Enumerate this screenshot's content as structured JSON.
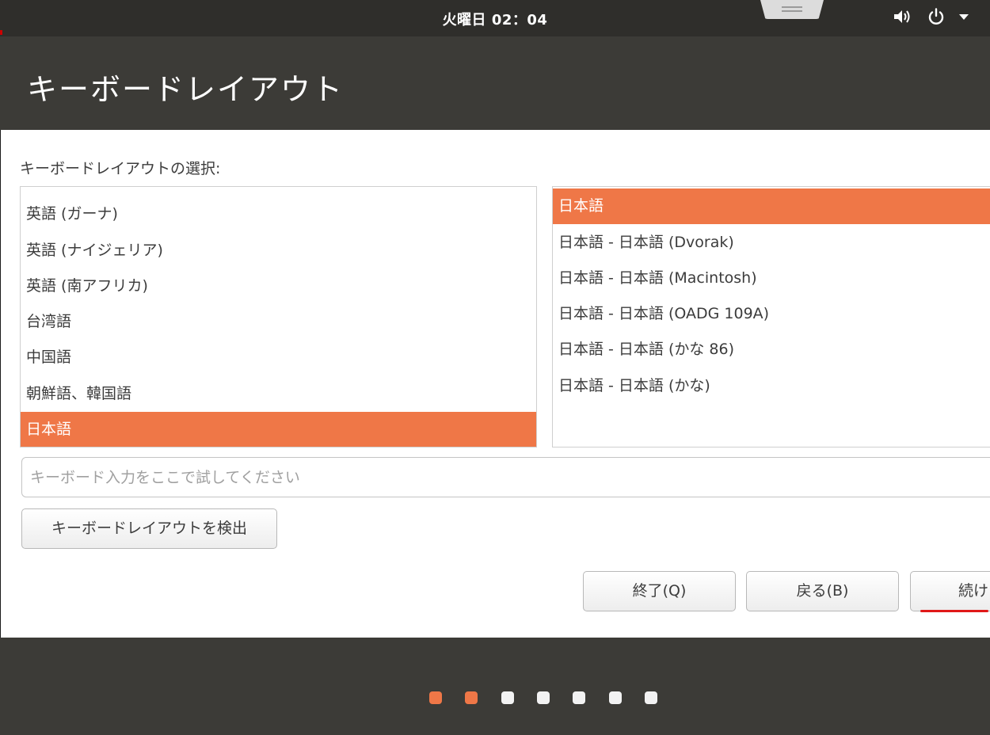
{
  "topbar": {
    "clock": "火曜日 02：04",
    "icons": [
      "volume-icon",
      "power-icon",
      "menu-arrow-icon"
    ]
  },
  "header": {
    "title": "キーボードレイアウト"
  },
  "main": {
    "section_label": "キーボードレイアウトの選択:",
    "layouts": [
      {
        "label": "英語 (ガーナ)",
        "selected": false
      },
      {
        "label": "英語 (ナイジェリア)",
        "selected": false
      },
      {
        "label": "英語 (南アフリカ)",
        "selected": false
      },
      {
        "label": "台湾語",
        "selected": false
      },
      {
        "label": "中国語",
        "selected": false
      },
      {
        "label": "朝鮮語、韓国語",
        "selected": false
      },
      {
        "label": "日本語",
        "selected": true
      }
    ],
    "variants": [
      {
        "label": "日本語",
        "selected": true
      },
      {
        "label": "日本語 - 日本語 (Dvorak)",
        "selected": false
      },
      {
        "label": "日本語 - 日本語 (Macintosh)",
        "selected": false
      },
      {
        "label": "日本語 - 日本語 (OADG 109A)",
        "selected": false
      },
      {
        "label": "日本語 - 日本語 (かな 86)",
        "selected": false
      },
      {
        "label": "日本語 - 日本語 (かな)",
        "selected": false
      }
    ],
    "test_input": {
      "placeholder": "キーボード入力をここで試してください",
      "value": ""
    },
    "detect_button": "キーボードレイアウトを検出"
  },
  "buttons": {
    "quit": "終了(Q)",
    "back": "戻る(B)",
    "continue": "続け"
  },
  "progress": {
    "total_steps": 7,
    "completed_steps": 2
  },
  "colors": {
    "accent": "#ef7747",
    "dark_bg": "#3c3b37",
    "topbar_bg": "#2f2e2b",
    "dot_inactive": "#f2f2f2",
    "underline_red": "#e01818"
  }
}
